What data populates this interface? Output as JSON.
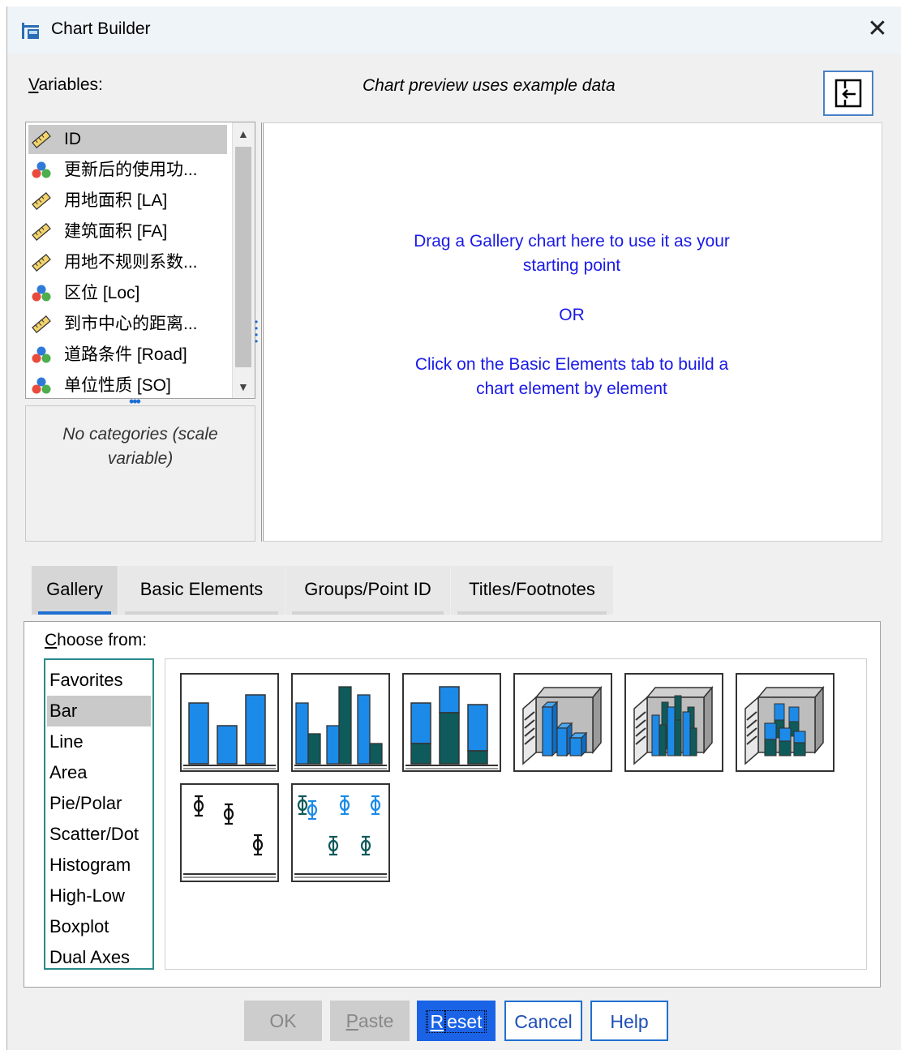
{
  "window": {
    "title": "Chart Builder"
  },
  "variables": {
    "label_ul": "V",
    "label_rest": "ariables:",
    "items": [
      {
        "icon": "scale-ruler-icon",
        "label": "ID",
        "selected": true
      },
      {
        "icon": "nominal-icon",
        "label": "更新后的使用功..."
      },
      {
        "icon": "scale-ruler-icon",
        "label": "用地面积 [LA]"
      },
      {
        "icon": "scale-ruler-icon",
        "label": "建筑面积 [FA]"
      },
      {
        "icon": "scale-ruler-icon",
        "label": "用地不规则系数..."
      },
      {
        "icon": "nominal-icon",
        "label": "区位 [Loc]"
      },
      {
        "icon": "scale-ruler-icon",
        "label": "到市中心的距离..."
      },
      {
        "icon": "nominal-icon",
        "label": "道路条件 [Road]"
      },
      {
        "icon": "nominal-icon",
        "label": "单位性质 [SO]"
      }
    ],
    "categories_note": "No categories (scale variable)"
  },
  "preview": {
    "note": "Chart preview uses example data",
    "line1": "Drag a Gallery chart here to use it as your",
    "line2": "starting point",
    "or": "OR",
    "line3": "Click on the Basic Elements tab to build a",
    "line4": "chart element by element"
  },
  "tabs": [
    {
      "label": "Gallery",
      "active": true
    },
    {
      "label": "Basic Elements"
    },
    {
      "label": "Groups/Point ID"
    },
    {
      "label": "Titles/Footnotes"
    }
  ],
  "gallery": {
    "choose_ul": "C",
    "choose_rest": "hoose from:",
    "types": [
      "Favorites",
      "Bar",
      "Line",
      "Area",
      "Pie/Polar",
      "Scatter/Dot",
      "Histogram",
      "High-Low",
      "Boxplot",
      "Dual Axes"
    ],
    "selected_type": "Bar",
    "thumbnails": [
      "simple-bar-icon",
      "clustered-bar-icon",
      "stacked-bar-icon",
      "simple-3d-bar-icon",
      "clustered-3d-bar-icon",
      "stacked-3d-bar-icon",
      "simple-error-bar-icon",
      "clustered-error-bar-icon"
    ]
  },
  "buttons": {
    "ok": "OK",
    "paste_ul": "P",
    "paste_rest": "aste",
    "reset_ul": "R",
    "reset_rest": "eset",
    "cancel": "Cancel",
    "help": "Help"
  },
  "colors": {
    "bar_blue": "#1c8ae8",
    "bar_teal": "#0f5a5a",
    "link_blue": "#1a1ae6",
    "accent": "#1f6fd1"
  }
}
